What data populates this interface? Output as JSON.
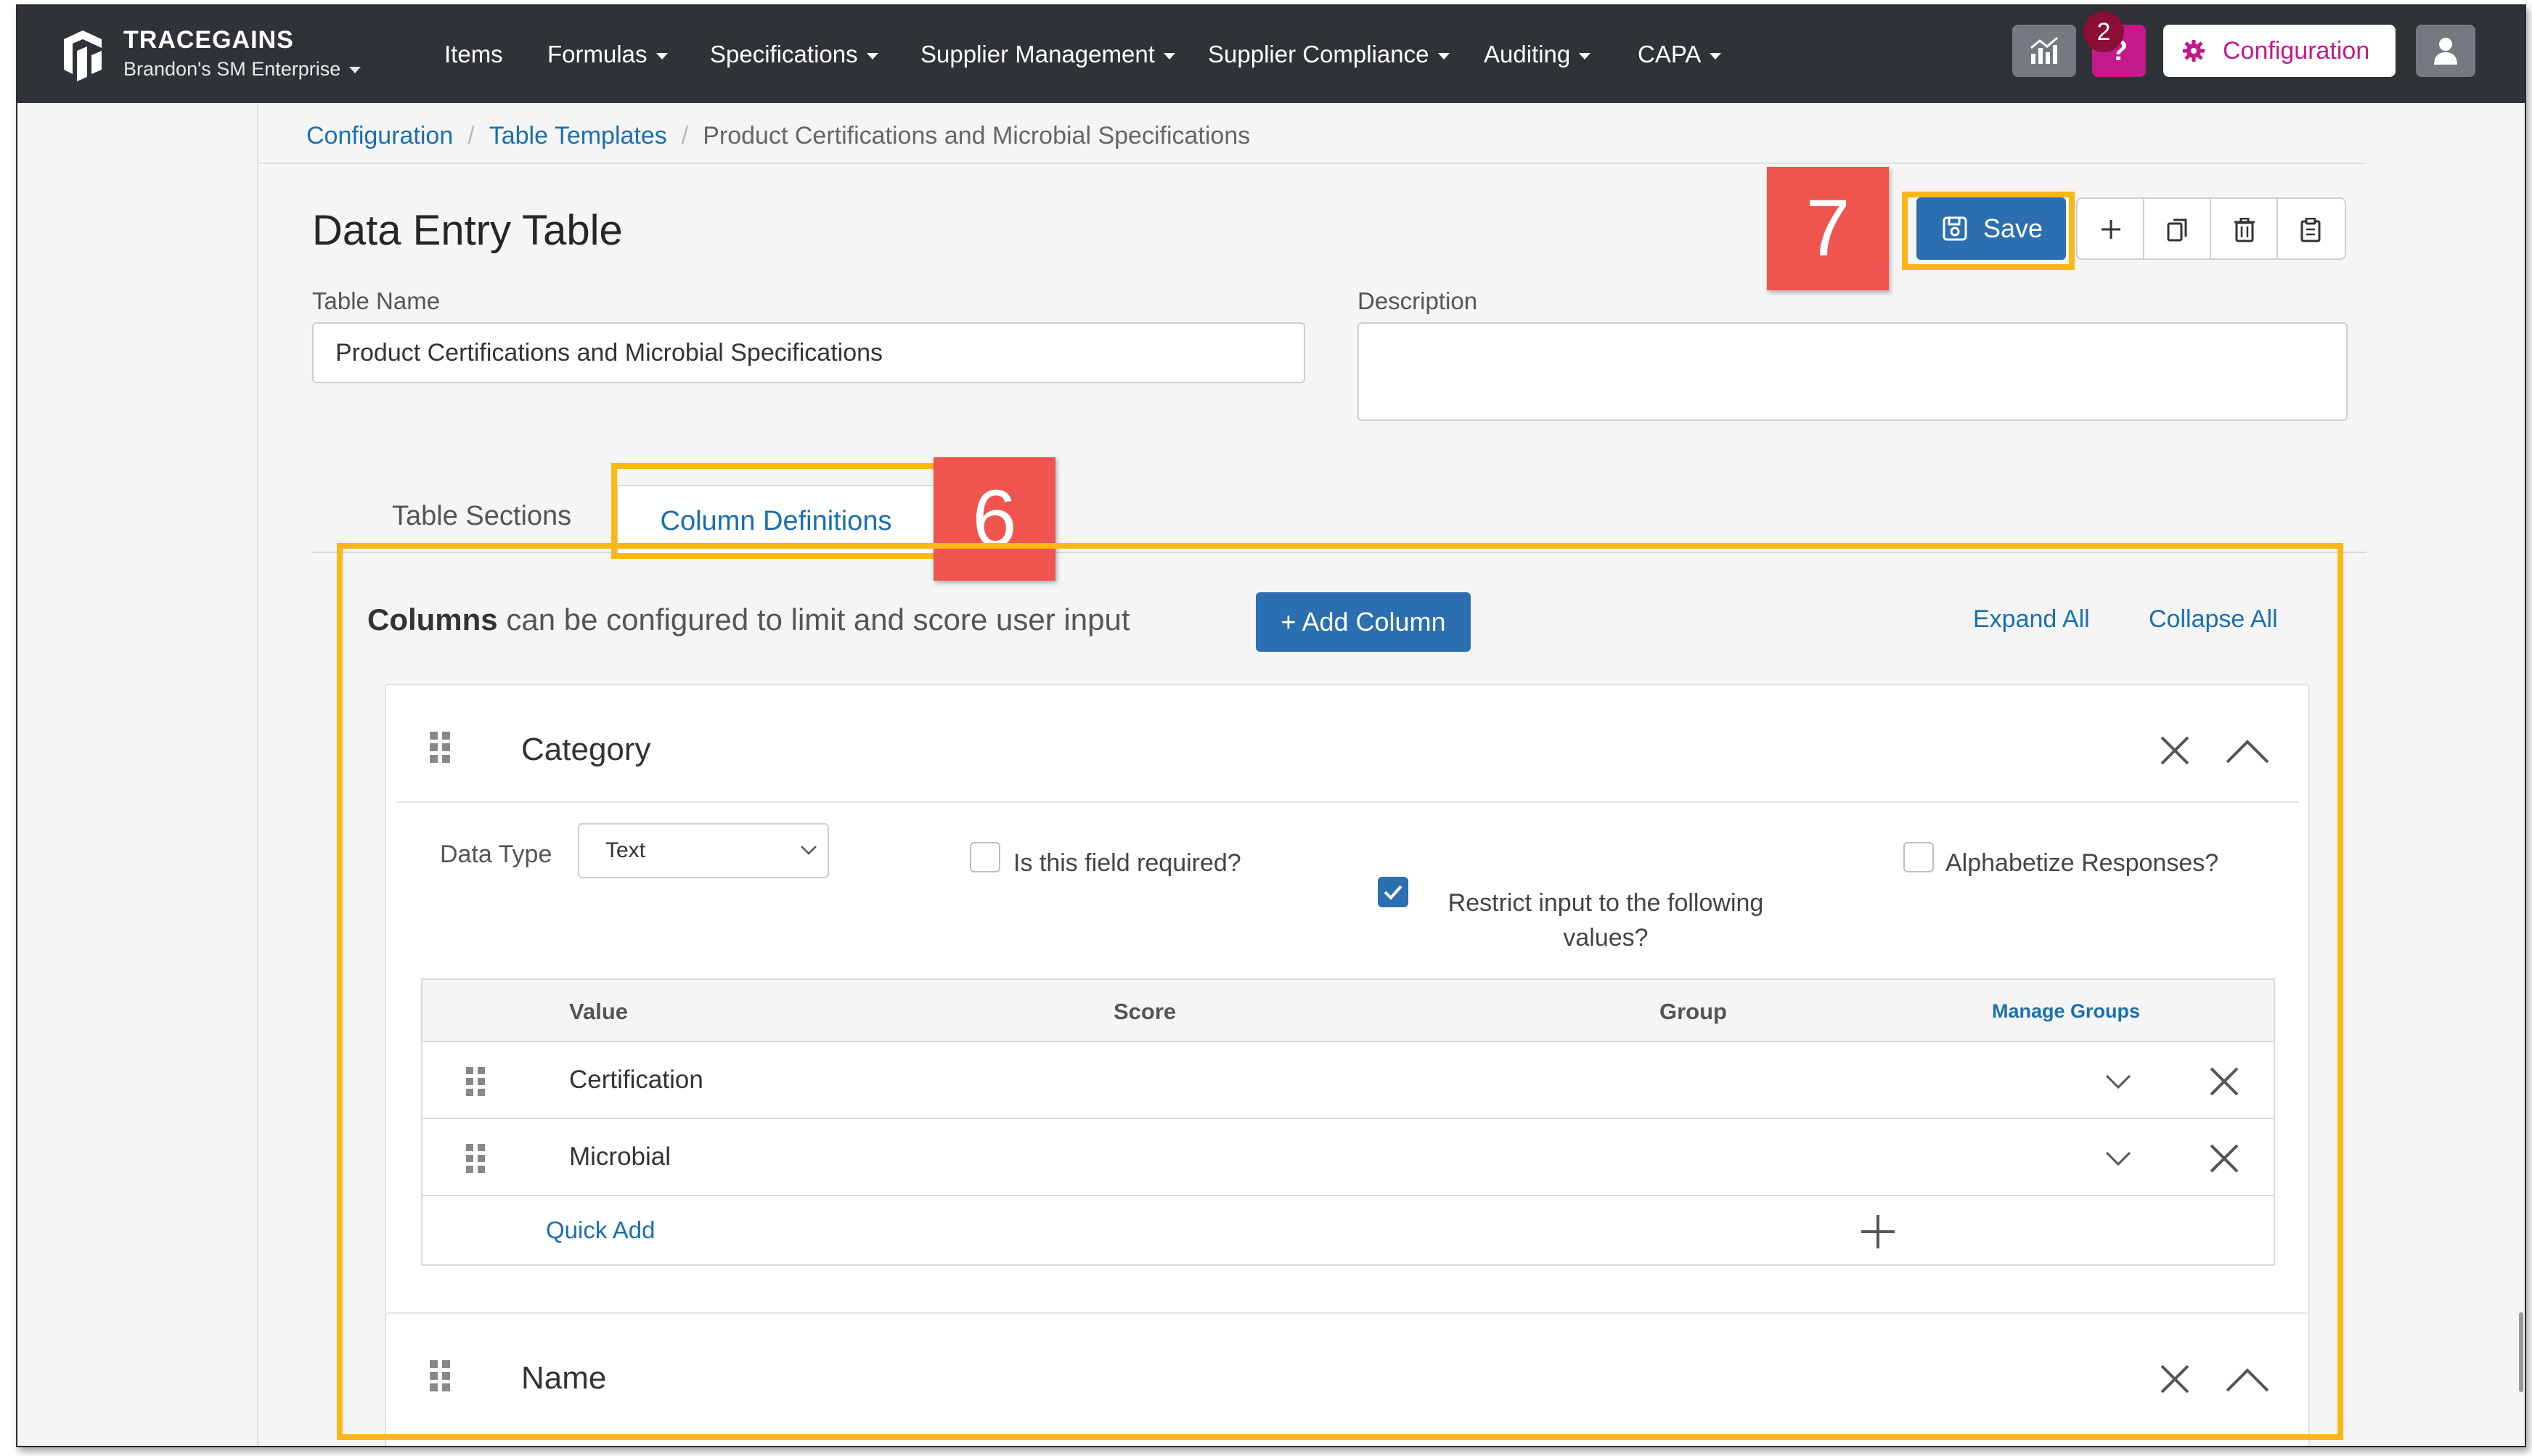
{
  "nav": {
    "brand": "TRACEGAINS",
    "tenant": "Brandon's SM Enterprise",
    "items": [
      {
        "label": "Items",
        "dropdown": false
      },
      {
        "label": "Formulas",
        "dropdown": true
      },
      {
        "label": "Specifications",
        "dropdown": true
      },
      {
        "label": "Supplier Management",
        "dropdown": true
      },
      {
        "label": "Supplier Compliance",
        "dropdown": true
      },
      {
        "label": "Auditing",
        "dropdown": true
      },
      {
        "label": "CAPA",
        "dropdown": true
      }
    ],
    "notification_count": "2",
    "help_label": "?",
    "config_label": "Configuration"
  },
  "breadcrumb": {
    "items": [
      "Configuration",
      "Table Templates"
    ],
    "current": "Product Certifications and Microbial Specifications"
  },
  "page": {
    "title": "Data Entry Table",
    "table_name_label": "Table Name",
    "table_name_value": "Product Certifications and Microbial Specifications",
    "description_label": "Description",
    "description_value": ""
  },
  "toolbar": {
    "save_label": "Save",
    "icons": [
      "plus-icon",
      "copy-icon",
      "trash-icon",
      "clipboard-icon"
    ]
  },
  "tabs": [
    {
      "label": "Table Sections",
      "active": false
    },
    {
      "label": "Column Definitions",
      "active": true
    }
  ],
  "columns_panel": {
    "intro_bold": "Columns",
    "intro_rest": " can be configured to limit and score user input",
    "add_column_label": "+ Add Column",
    "expand_all": "Expand All",
    "collapse_all": "Collapse All"
  },
  "columns": [
    {
      "title": "Category",
      "data_type_label": "Data Type",
      "data_type_value": "Text",
      "required_label": "Is this field required?",
      "required_checked": false,
      "restrict_label_line1": "Restrict input to the following",
      "restrict_label_line2": "values?",
      "restrict_checked": true,
      "alphabetize_label": "Alphabetize Responses?",
      "alphabetize_checked": false,
      "values_table": {
        "headers": {
          "value": "Value",
          "score": "Score",
          "group": "Group",
          "manage": "Manage Groups"
        },
        "rows": [
          {
            "value": "Certification"
          },
          {
            "value": "Microbial"
          }
        ],
        "quick_add": "Quick Add"
      }
    },
    {
      "title": "Name"
    }
  ],
  "annotations": {
    "step_save": "7",
    "step_columns": "6",
    "highlight_color": "#fbb814",
    "callout_color": "#f0544f"
  },
  "colors": {
    "navbar": "#2f3236",
    "primary": "#2b6fb0",
    "accent_magenta": "#c3198a"
  }
}
